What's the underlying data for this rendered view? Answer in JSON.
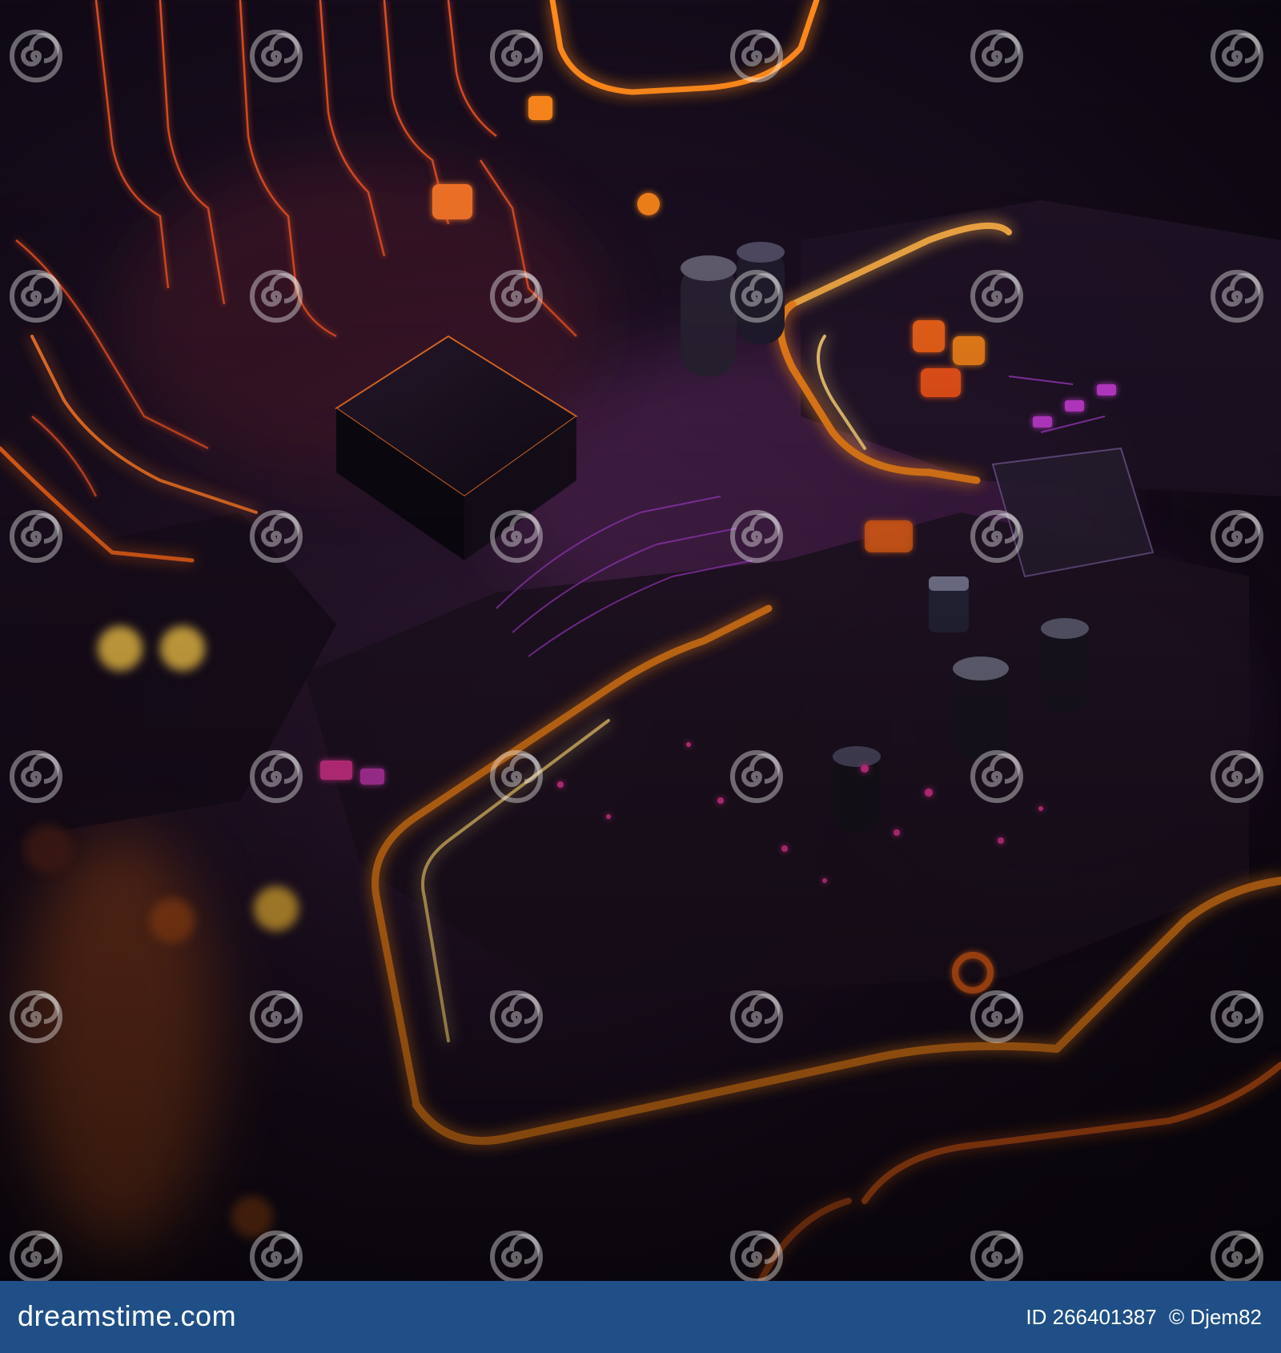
{
  "image": {
    "subject": "glowing circuit board",
    "colors": {
      "background": "#0b0710",
      "trace_glow": "#ff8a1e",
      "trace_core": "#ffd27a",
      "accent_purple": "#b040d8",
      "accent_magenta": "#ff3ca8",
      "chip": "#1a1320",
      "footer_bar": "#1f4f86"
    },
    "watermark_icon": "spiral-logo-icon"
  },
  "footer": {
    "logo_text": "dreamstime.com",
    "id_text": "ID 266401387",
    "credit_text": "© Djem82"
  }
}
